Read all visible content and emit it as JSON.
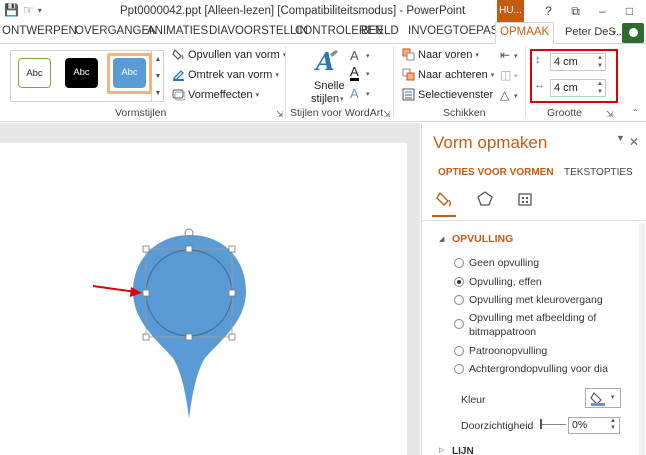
{
  "titlebar": {
    "title": "Ppt0000042.ppt [Alleen-lezen] [Compatibiliteitsmodus] - PowerPoint",
    "context_tab": "HU...",
    "buttons": [
      "?",
      "⧉",
      "–",
      "□",
      "✕"
    ]
  },
  "tabs": {
    "items": [
      "ONTWERPEN",
      "OVERGANGEN",
      "ANIMATIES",
      "DIAVOORSTELLIN",
      "CONTROLEREN",
      "BEELD",
      "INVOEGTOEPASSI",
      "OPMAAK"
    ],
    "active": "OPMAAK",
    "user": "Peter DeS..."
  },
  "ribbon": {
    "style_samples": [
      "Abc",
      "Abc",
      "Abc"
    ],
    "vormstijlen": {
      "fill": "Opvullen van vorm",
      "outline": "Omtrek van vorm",
      "effects": "Vormeffecten",
      "label": "Vormstijlen"
    },
    "wordart": {
      "quick_styles_1": "Snelle",
      "quick_styles_2": "stijlen",
      "label": "Stijlen voor WordArt"
    },
    "schikken": {
      "forward": "Naar voren",
      "backward": "Naar achteren",
      "selection": "Selectievenster",
      "label": "Schikken"
    },
    "grootte": {
      "height": "4 cm",
      "width": "4 cm",
      "label": "Grootte"
    }
  },
  "pane": {
    "title": "Vorm opmaken",
    "tab_shape": "OPTIES VOOR VORMEN",
    "tab_text": "TEKSTOPTIES",
    "section": "OPVULLING",
    "options": [
      "Geen opvulling",
      "Opvulling, effen",
      "Opvulling met kleurovergang",
      "Opvulling met afbeelding of",
      "bitmappatroon",
      "Patroonopvulling",
      "Achtergrondopvulling voor dia"
    ],
    "color_label": "Kleur",
    "transparency_label": "Doorzichtigheid",
    "transparency_value": "0%",
    "next_section": "LIJN"
  },
  "colors": {
    "accent": "#c55a11",
    "shape_fill": "#5b9bd5",
    "arrow": "#e00000"
  }
}
